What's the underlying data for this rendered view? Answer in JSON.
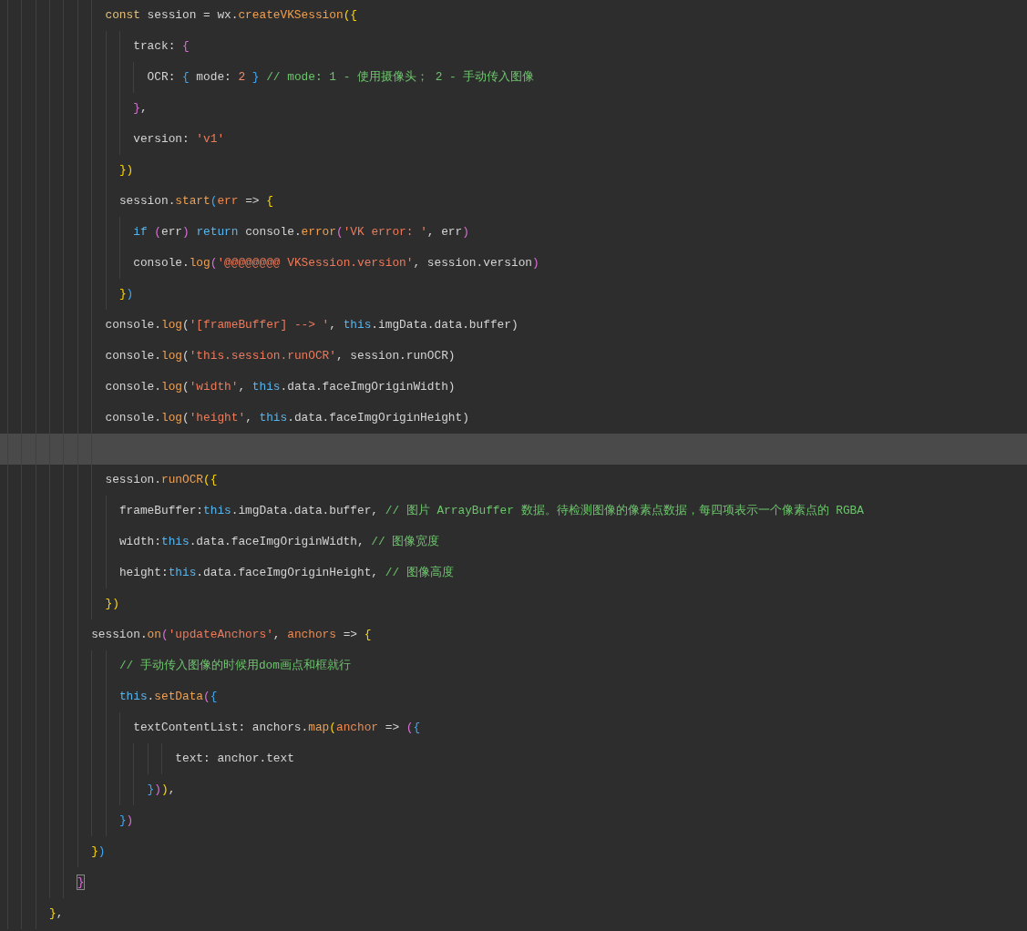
{
  "editor": {
    "lines": [
      {
        "children": [
          {
            "children": [
              {
                "children": [
                  {
                    "children": [
                      {
                        "selected": false,
                        "tokens": [
                          {
                            "kind": "keyword",
                            "text": "const"
                          },
                          {
                            "kind": "plain",
                            "text": " session = wx."
                          },
                          {
                            "kind": "function",
                            "text": "createVKSession"
                          },
                          {
                            "kind": "bracket1",
                            "text": "({"
                          }
                        ]
                      },
                      {
                        "children": [
                          {
                            "children": [
                              {
                                "selected": false,
                                "tokens": [
                                  {
                                    "kind": "plain",
                                    "text": "track: "
                                  },
                                  {
                                    "kind": "bracket2",
                                    "text": "{"
                                  }
                                ]
                              },
                              {
                                "children": [
                                  {
                                    "selected": false,
                                    "tokens": [
                                      {
                                        "kind": "plain",
                                        "text": "OCR: "
                                      },
                                      {
                                        "kind": "bracket3",
                                        "text": "{"
                                      },
                                      {
                                        "kind": "plain",
                                        "text": " mode: "
                                      },
                                      {
                                        "kind": "number",
                                        "text": "2 "
                                      },
                                      {
                                        "kind": "bracket3",
                                        "text": "} "
                                      },
                                      {
                                        "kind": "comment",
                                        "text": "// mode: 1 - 使用摄像头； 2 - 手动传入图像"
                                      }
                                    ]
                                  }
                                ]
                              },
                              {
                                "selected": false,
                                "tokens": [
                                  {
                                    "kind": "bracket2",
                                    "text": "}"
                                  },
                                  {
                                    "kind": "plain",
                                    "text": ","
                                  }
                                ]
                              },
                              {
                                "selected": false,
                                "tokens": [
                                  {
                                    "kind": "plain",
                                    "text": "version: "
                                  },
                                  {
                                    "kind": "string",
                                    "text": "'v1'"
                                  }
                                ]
                              }
                            ]
                          },
                          {
                            "selected": false,
                            "tokens": [
                              {
                                "kind": "bracket1",
                                "text": "})"
                              }
                            ]
                          },
                          {
                            "selected": false,
                            "tokens": [
                              {
                                "kind": "plain",
                                "text": "session."
                              },
                              {
                                "kind": "function",
                                "text": "start"
                              },
                              {
                                "kind": "bracket3",
                                "text": "("
                              },
                              {
                                "kind": "param",
                                "text": "err"
                              },
                              {
                                "kind": "plain",
                                "text": " => "
                              },
                              {
                                "kind": "bracket1",
                                "text": "{"
                              }
                            ]
                          },
                          {
                            "children": [
                              {
                                "selected": false,
                                "tokens": [
                                  {
                                    "kind": "control",
                                    "text": "if "
                                  },
                                  {
                                    "kind": "bracket2",
                                    "text": "("
                                  },
                                  {
                                    "kind": "plain",
                                    "text": "err"
                                  },
                                  {
                                    "kind": "bracket2",
                                    "text": ") "
                                  },
                                  {
                                    "kind": "control",
                                    "text": "return"
                                  },
                                  {
                                    "kind": "plain",
                                    "text": " console."
                                  },
                                  {
                                    "kind": "function",
                                    "text": "error"
                                  },
                                  {
                                    "kind": "bracket2",
                                    "text": "("
                                  },
                                  {
                                    "kind": "string",
                                    "text": "'VK error: '"
                                  },
                                  {
                                    "kind": "plain",
                                    "text": ", err"
                                  },
                                  {
                                    "kind": "bracket2",
                                    "text": ")"
                                  }
                                ]
                              },
                              {
                                "selected": false,
                                "tokens": [
                                  {
                                    "kind": "plain",
                                    "text": "console."
                                  },
                                  {
                                    "kind": "function",
                                    "text": "log"
                                  },
                                  {
                                    "kind": "bracket2",
                                    "text": "("
                                  },
                                  {
                                    "kind": "string",
                                    "text": "'@@@@@@@@ VKSession.version'"
                                  },
                                  {
                                    "kind": "plain",
                                    "text": ", session.version"
                                  },
                                  {
                                    "kind": "bracket2",
                                    "text": ")"
                                  }
                                ]
                              }
                            ]
                          },
                          {
                            "selected": false,
                            "tokens": [
                              {
                                "kind": "bracket1",
                                "text": "}"
                              },
                              {
                                "kind": "bracket3",
                                "text": ")"
                              }
                            ]
                          }
                        ]
                      },
                      {
                        "selected": false,
                        "tokens": [
                          {
                            "kind": "plain",
                            "text": "console."
                          },
                          {
                            "kind": "function",
                            "text": "log"
                          },
                          {
                            "kind": "plain",
                            "text": "("
                          },
                          {
                            "kind": "string",
                            "text": "'[frameBuffer] --> '"
                          },
                          {
                            "kind": "plain",
                            "text": ", "
                          },
                          {
                            "kind": "this",
                            "text": "this"
                          },
                          {
                            "kind": "plain",
                            "text": ".imgData.data.buffer)"
                          }
                        ]
                      },
                      {
                        "selected": false,
                        "tokens": [
                          {
                            "kind": "plain",
                            "text": "console."
                          },
                          {
                            "kind": "function",
                            "text": "log"
                          },
                          {
                            "kind": "plain",
                            "text": "("
                          },
                          {
                            "kind": "string",
                            "text": "'this.session.runOCR'"
                          },
                          {
                            "kind": "plain",
                            "text": ", session.runOCR)"
                          }
                        ]
                      },
                      {
                        "selected": false,
                        "tokens": [
                          {
                            "kind": "plain",
                            "text": "console."
                          },
                          {
                            "kind": "function",
                            "text": "log"
                          },
                          {
                            "kind": "plain",
                            "text": "("
                          },
                          {
                            "kind": "string",
                            "text": "'width'"
                          },
                          {
                            "kind": "plain",
                            "text": ", "
                          },
                          {
                            "kind": "this",
                            "text": "this"
                          },
                          {
                            "kind": "plain",
                            "text": ".data.faceImgOriginWidth)"
                          }
                        ]
                      },
                      {
                        "selected": false,
                        "tokens": [
                          {
                            "kind": "plain",
                            "text": "console."
                          },
                          {
                            "kind": "function",
                            "text": "log"
                          },
                          {
                            "kind": "plain",
                            "text": "("
                          },
                          {
                            "kind": "string",
                            "text": "'height'"
                          },
                          {
                            "kind": "plain",
                            "text": ", "
                          },
                          {
                            "kind": "this",
                            "text": "this"
                          },
                          {
                            "kind": "plain",
                            "text": ".data.faceImgOriginHeight)"
                          }
                        ]
                      },
                      {
                        "selected": true
                      },
                      {
                        "selected": false,
                        "tokens": [
                          {
                            "kind": "plain",
                            "text": "session."
                          },
                          {
                            "kind": "function",
                            "text": "runOCR"
                          },
                          {
                            "kind": "bracket1",
                            "text": "({"
                          }
                        ]
                      },
                      {
                        "children": [
                          {
                            "selected": false,
                            "tokens": [
                              {
                                "kind": "plain",
                                "text": "frameBuffer:"
                              },
                              {
                                "kind": "this",
                                "text": "this"
                              },
                              {
                                "kind": "plain",
                                "text": ".imgData.data.buffer, "
                              },
                              {
                                "kind": "comment",
                                "text": "// 图片 ArrayBuffer 数据。待检测图像的像素点数据，每四项表示一个像素点的 RGBA"
                              }
                            ]
                          },
                          {
                            "selected": false,
                            "tokens": [
                              {
                                "kind": "plain",
                                "text": "width:"
                              },
                              {
                                "kind": "this",
                                "text": "this"
                              },
                              {
                                "kind": "plain",
                                "text": ".data.faceImgOriginWidth, "
                              },
                              {
                                "kind": "comment",
                                "text": "// 图像宽度"
                              }
                            ]
                          },
                          {
                            "selected": false,
                            "tokens": [
                              {
                                "kind": "plain",
                                "text": "height:"
                              },
                              {
                                "kind": "this",
                                "text": "this"
                              },
                              {
                                "kind": "plain",
                                "text": ".data.faceImgOriginHeight, "
                              },
                              {
                                "kind": "comment",
                                "text": "// 图像高度"
                              }
                            ]
                          }
                        ]
                      },
                      {
                        "selected": false,
                        "tokens": [
                          {
                            "kind": "bracket1",
                            "text": "})"
                          }
                        ]
                      }
                    ]
                  },
                  {
                    "selected": false,
                    "tokens": [
                      {
                        "kind": "plain",
                        "text": "session."
                      },
                      {
                        "kind": "function",
                        "text": "on"
                      },
                      {
                        "kind": "bracket2",
                        "text": "("
                      },
                      {
                        "kind": "string",
                        "text": "'updateAnchors'"
                      },
                      {
                        "kind": "plain",
                        "text": ", "
                      },
                      {
                        "kind": "param",
                        "text": "anchors"
                      },
                      {
                        "kind": "plain",
                        "text": " => "
                      },
                      {
                        "kind": "bracket1",
                        "text": "{"
                      }
                    ]
                  },
                  {
                    "children": [
                      {
                        "children": [
                          {
                            "selected": false,
                            "tokens": [
                              {
                                "kind": "comment",
                                "text": "// 手动传入图像的时候用dom画点和框就行"
                              }
                            ]
                          },
                          {
                            "selected": false,
                            "tokens": [
                              {
                                "kind": "this",
                                "text": "this"
                              },
                              {
                                "kind": "plain",
                                "text": "."
                              },
                              {
                                "kind": "function",
                                "text": "setData"
                              },
                              {
                                "kind": "bracket2",
                                "text": "("
                              },
                              {
                                "kind": "bracket3",
                                "text": "{"
                              }
                            ]
                          },
                          {
                            "children": [
                              {
                                "selected": false,
                                "tokens": [
                                  {
                                    "kind": "plain",
                                    "text": "textContentList: anchors."
                                  },
                                  {
                                    "kind": "function",
                                    "text": "map"
                                  },
                                  {
                                    "kind": "bracket1",
                                    "text": "("
                                  },
                                  {
                                    "kind": "param",
                                    "text": "anchor"
                                  },
                                  {
                                    "kind": "plain",
                                    "text": " => "
                                  },
                                  {
                                    "kind": "bracket2",
                                    "text": "("
                                  },
                                  {
                                    "kind": "bracket3",
                                    "text": "{"
                                  }
                                ]
                              },
                              {
                                "children": [
                                  {
                                    "children": [
                                      {
                                        "children": [
                                          {
                                            "selected": false,
                                            "tokens": [
                                              {
                                                "kind": "plain",
                                                "text": "text: anchor.text"
                                              }
                                            ]
                                          }
                                        ]
                                      }
                                    ]
                                  },
                                  {
                                    "selected": false,
                                    "tokens": [
                                      {
                                        "kind": "bracket3",
                                        "text": "}"
                                      },
                                      {
                                        "kind": "bracket2",
                                        "text": ")"
                                      },
                                      {
                                        "kind": "bracket1",
                                        "text": ")"
                                      },
                                      {
                                        "kind": "plain",
                                        "text": ","
                                      }
                                    ]
                                  }
                                ]
                              }
                            ]
                          },
                          {
                            "selected": false,
                            "tokens": [
                              {
                                "kind": "bracket3",
                                "text": "}"
                              },
                              {
                                "kind": "bracket2",
                                "text": ")"
                              }
                            ]
                          }
                        ]
                      }
                    ]
                  },
                  {
                    "selected": false,
                    "tokens": [
                      {
                        "kind": "bracket1",
                        "text": "}"
                      },
                      {
                        "kind": "bracket3",
                        "text": ")"
                      }
                    ]
                  }
                ]
              },
              {
                "selected": false,
                "tokens": [
                  {
                    "kind": "matched_bracket",
                    "text": "}"
                  }
                ]
              }
            ]
          }
        ]
      },
      {
        "selected": false,
        "tokens": [
          {
            "kind": "bracket1",
            "text": "}"
          },
          {
            "kind": "plain",
            "text": ","
          }
        ]
      }
    ]
  }
}
